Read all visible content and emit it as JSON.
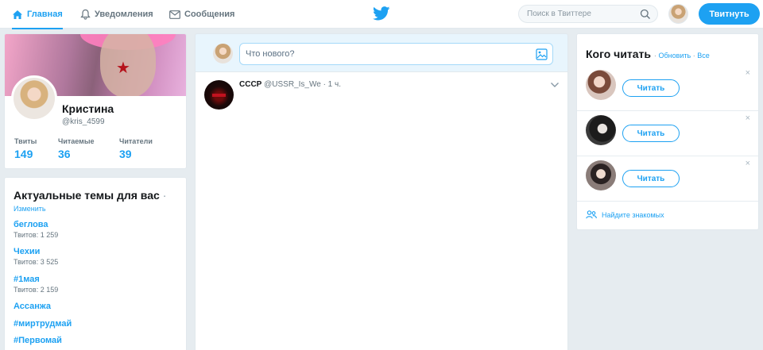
{
  "nav": {
    "home": "Главная",
    "notifications": "Уведомления",
    "messages": "Сообщения"
  },
  "search": {
    "placeholder": "Поиск в Твиттере"
  },
  "tweet_button": "Твитнуть",
  "profile": {
    "name": "Кристина",
    "handle": "@kris_4599",
    "stats": [
      {
        "label": "Твиты",
        "value": "149"
      },
      {
        "label": "Читаемые",
        "value": "36"
      },
      {
        "label": "Читатели",
        "value": "39"
      }
    ]
  },
  "trends": {
    "title": "Актуальные темы для вас",
    "dot": "·",
    "change": "Изменить",
    "items": [
      {
        "name": "беглова",
        "count": "Твитов: 1 259"
      },
      {
        "name": "Чехии",
        "count": "Твитов: 3 525"
      },
      {
        "name": "#1мая",
        "count": "Твитов: 2 159"
      },
      {
        "name": "Ассанжа",
        "count": ""
      },
      {
        "name": "#миртрудмай",
        "count": ""
      },
      {
        "name": "#Первомай",
        "count": ""
      }
    ]
  },
  "compose": {
    "placeholder": "Что нового?"
  },
  "tweet": {
    "name": "СССР",
    "handle": "@USSR_Is_We",
    "time": "· 1 ч."
  },
  "who_to_follow": {
    "title": "Кого читать",
    "dot": "·",
    "refresh": "Обновить",
    "all": "Все",
    "suggestions": [
      {
        "button": "Читать",
        "close": "×"
      },
      {
        "button": "Читать",
        "close": "×"
      },
      {
        "button": "Читать",
        "close": "×"
      }
    ],
    "find_friends": "Найдите знакомых"
  },
  "colors": {
    "accent": "#1da1f2",
    "background": "#e6ecf0",
    "muted": "#66757f"
  }
}
